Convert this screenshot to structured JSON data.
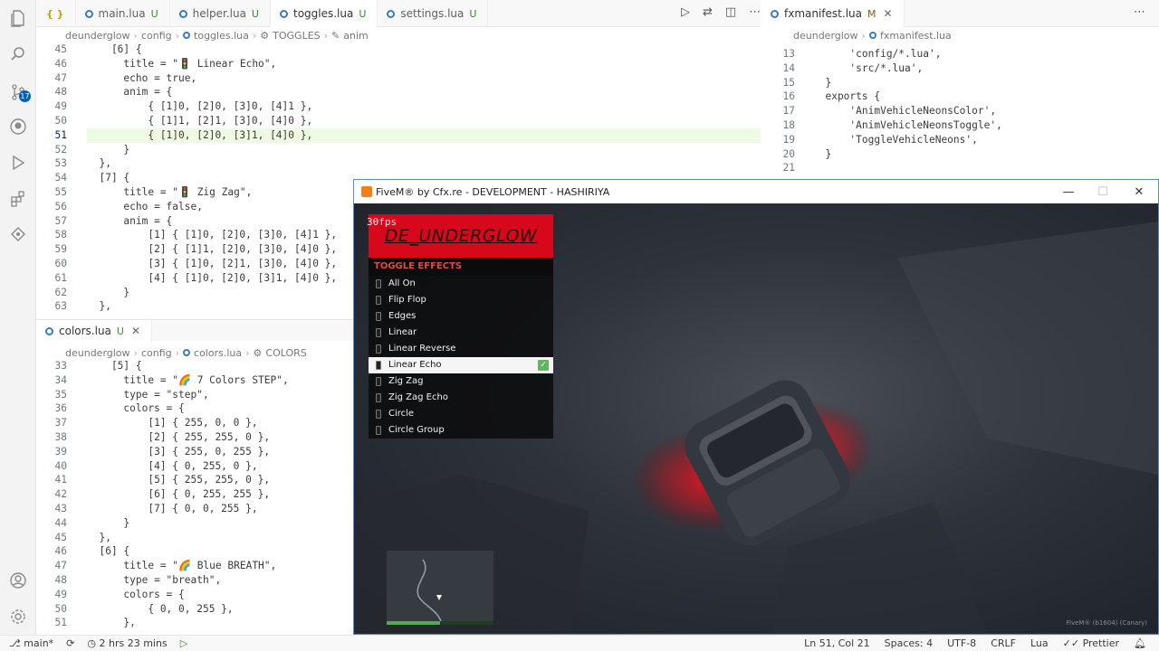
{
  "editor_left": {
    "tabs": [
      {
        "label": "main.lua",
        "status": "U"
      },
      {
        "label": "helper.lua",
        "status": "U"
      },
      {
        "label": "toggles.lua",
        "status": "U"
      },
      {
        "label": "settings.lua",
        "status": "U"
      }
    ],
    "breadcrumb": [
      "deunderglow",
      "config",
      "toggles.lua",
      "TOGGLES",
      "anim"
    ],
    "line_numbers": [
      "45",
      "46",
      "47",
      "48",
      "49",
      "50",
      "51",
      "52",
      "53",
      "54",
      "55",
      "56",
      "57",
      "58",
      "59",
      "60",
      "61",
      "62",
      "63"
    ],
    "code": [
      "    [6] {",
      "      title = \"🚦 Linear Echo\",",
      "      echo = true,",
      "      anim = {",
      "          { [1]0, [2]0, [3]0, [4]1 },",
      "          { [1]1, [2]1, [3]0, [4]0 },",
      "          { [1]0, [2]0, [3]1, [4]0 },",
      "      }",
      "  },",
      "  [7] {",
      "      title = \"🚦 Zig Zag\",",
      "      echo = false,",
      "      anim = {",
      "          [1] { [1]0, [2]0, [3]0, [4]1 },",
      "          [2] { [1]1, [2]0, [3]0, [4]0 },",
      "          [3] { [1]0, [2]1, [3]0, [4]0 },",
      "          [4] { [1]0, [2]0, [3]1, [4]0 },",
      "      }",
      "  },"
    ]
  },
  "panel_bottom": {
    "tab": {
      "label": "colors.lua",
      "status": "U"
    },
    "breadcrumb": [
      "deunderglow",
      "config",
      "colors.lua",
      "COLORS"
    ],
    "line_numbers": [
      "33",
      "34",
      "35",
      "36",
      "37",
      "38",
      "39",
      "40",
      "41",
      "42",
      "43",
      "44",
      "45",
      "46",
      "47",
      "48",
      "49",
      "50",
      "51"
    ],
    "code": [
      "    [5] {",
      "      title = \"🌈 7 Colors STEP\",",
      "      type = \"step\",",
      "      colors = {",
      "          [1] { 255, 0, 0 },",
      "          [2] { 255, 255, 0 },",
      "          [3] { 255, 0, 255 },",
      "          [4] { 0, 255, 0 },",
      "          [5] { 255, 255, 0 },",
      "          [6] { 0, 255, 255 },",
      "          [7] { 0, 0, 255 },",
      "      }",
      "  },",
      "  [6] {",
      "      title = \"🌈 Blue BREATH\",",
      "      type = \"breath\",",
      "      colors = {",
      "          { 0, 0, 255 },",
      "      },"
    ]
  },
  "editor_right": {
    "tab": {
      "label": "fxmanifest.lua",
      "status": "M"
    },
    "breadcrumb": [
      "deunderglow",
      "fxmanifest.lua"
    ],
    "line_numbers": [
      "13",
      "14",
      "15",
      "16",
      "17",
      "18",
      "19",
      "20",
      "21"
    ],
    "code": [
      "      'config/*.lua',",
      "      'src/*.lua',",
      "  }",
      "",
      "  exports {",
      "      'AnimVehicleNeonsColor',",
      "      'AnimVehicleNeonsToggle',",
      "      'ToggleVehicleNeons',",
      "  }"
    ]
  },
  "fivem": {
    "window_title": "FiveM® by Cfx.re - DEVELOPMENT - HASHIRIYA",
    "fps": "30fps",
    "menu_title": "DE_UNDERGLOW",
    "menu_subtitle": "TOGGLE EFFECTS",
    "menu_items": [
      "All On",
      "Flip Flop",
      "Edges",
      "Linear",
      "Linear Reverse",
      "Linear Echo",
      "Zig Zag",
      "Zig Zag Echo",
      "Circle",
      "Circle Group"
    ],
    "selected_item": "Linear Echo",
    "watermark": "FiveM® (b1604) (Canary)",
    "health_fraction": 0.5
  },
  "statusbar": {
    "branch": "main*",
    "time": "2 hrs 23 mins",
    "cursor": "Ln 51, Col 21",
    "spaces": "Spaces: 4",
    "encoding": "UTF-8",
    "eol": "CRLF",
    "language": "Lua",
    "formatter": "Prettier"
  },
  "colors": {
    "accent": "#005fb8",
    "menu_header": "#d8081c",
    "menu_subtitle": "#e8483f",
    "neon_glow": "#ff1020"
  },
  "icons": [
    "explorer-icon",
    "search-icon",
    "source-control-icon",
    "github-icon",
    "run-debug-icon",
    "extensions-icon",
    "remote-icon",
    "account-icon",
    "settings-gear-icon",
    "play-icon",
    "split-editor-icon",
    "more-icon"
  ]
}
